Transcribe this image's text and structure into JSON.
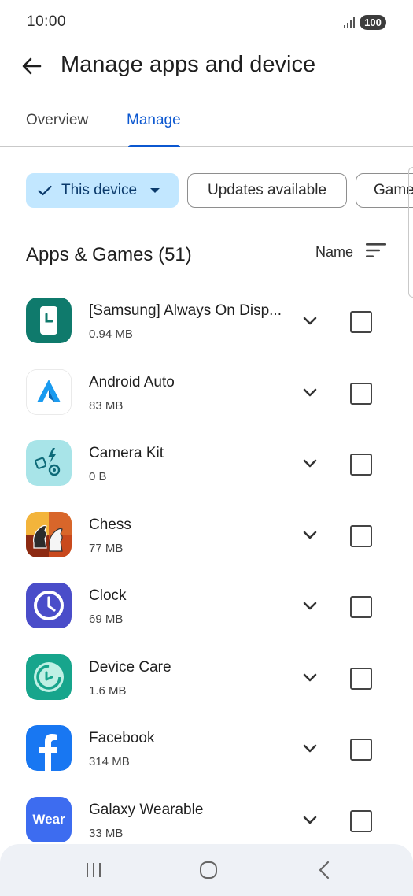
{
  "status": {
    "time": "10:00",
    "battery": "100"
  },
  "header": {
    "title": "Manage apps and device"
  },
  "tabs": [
    {
      "label": "Overview",
      "selected": false
    },
    {
      "label": "Manage",
      "selected": true
    }
  ],
  "filters": [
    {
      "label": "This device",
      "selected": true
    },
    {
      "label": "Updates available",
      "selected": false
    },
    {
      "label": "Game",
      "selected": false
    }
  ],
  "section": {
    "title": "Apps & Games (51)",
    "sort_label": "Name"
  },
  "apps": [
    {
      "name": "[Samsung] Always On Disp...",
      "size": "0.94 MB",
      "icon": "always-on-display-icon"
    },
    {
      "name": "Android Auto",
      "size": "83 MB",
      "icon": "android-auto-icon"
    },
    {
      "name": "Camera Kit",
      "size": "0 B",
      "icon": "camera-kit-icon"
    },
    {
      "name": "Chess",
      "size": "77 MB",
      "icon": "chess-icon"
    },
    {
      "name": "Clock",
      "size": "69 MB",
      "icon": "clock-icon"
    },
    {
      "name": "Device Care",
      "size": "1.6 MB",
      "icon": "device-care-icon"
    },
    {
      "name": "Facebook",
      "size": "314 MB",
      "icon": "facebook-icon"
    },
    {
      "name": "Galaxy Wearable",
      "size": "33 MB",
      "icon": "galaxy-wearable-icon",
      "icon_text": "Wear"
    }
  ],
  "colors": {
    "accent": "#0b57d0",
    "chip_selected": "#c2e7ff",
    "nav_bg": "#eef1f6"
  }
}
